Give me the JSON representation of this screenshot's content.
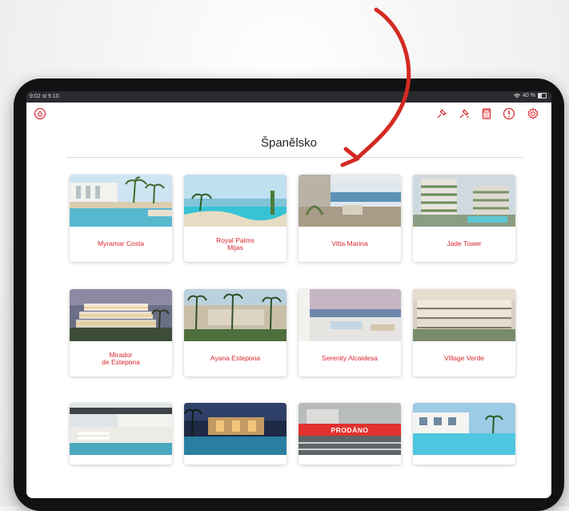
{
  "status_bar": {
    "time": "9:02",
    "date": "st 9.10.",
    "battery": "40 %",
    "battery_level": 0.4
  },
  "toolbar": {
    "left_icon": "logo-badge-icon",
    "right_icons": [
      "pin-icon",
      "pin-alt-icon",
      "calculator-icon",
      "alert-icon",
      "gear-icon"
    ]
  },
  "page": {
    "title": "Španělsko"
  },
  "colors": {
    "accent": "#d8262e",
    "sold_badge": "#e1322e"
  },
  "properties": [
    {
      "name": "Myramar Costa"
    },
    {
      "name": "Royal Palms\nMijas"
    },
    {
      "name": "Vitta Marina"
    },
    {
      "name": "Jade Tower"
    },
    {
      "name": "Mirador\nde Estepona"
    },
    {
      "name": "Ayana Estepona"
    },
    {
      "name": "Serenity Alcaidesa"
    },
    {
      "name": "Village Verde"
    },
    {
      "name": ""
    },
    {
      "name": ""
    },
    {
      "name": "",
      "badge": "PRODÁNO"
    },
    {
      "name": ""
    }
  ]
}
